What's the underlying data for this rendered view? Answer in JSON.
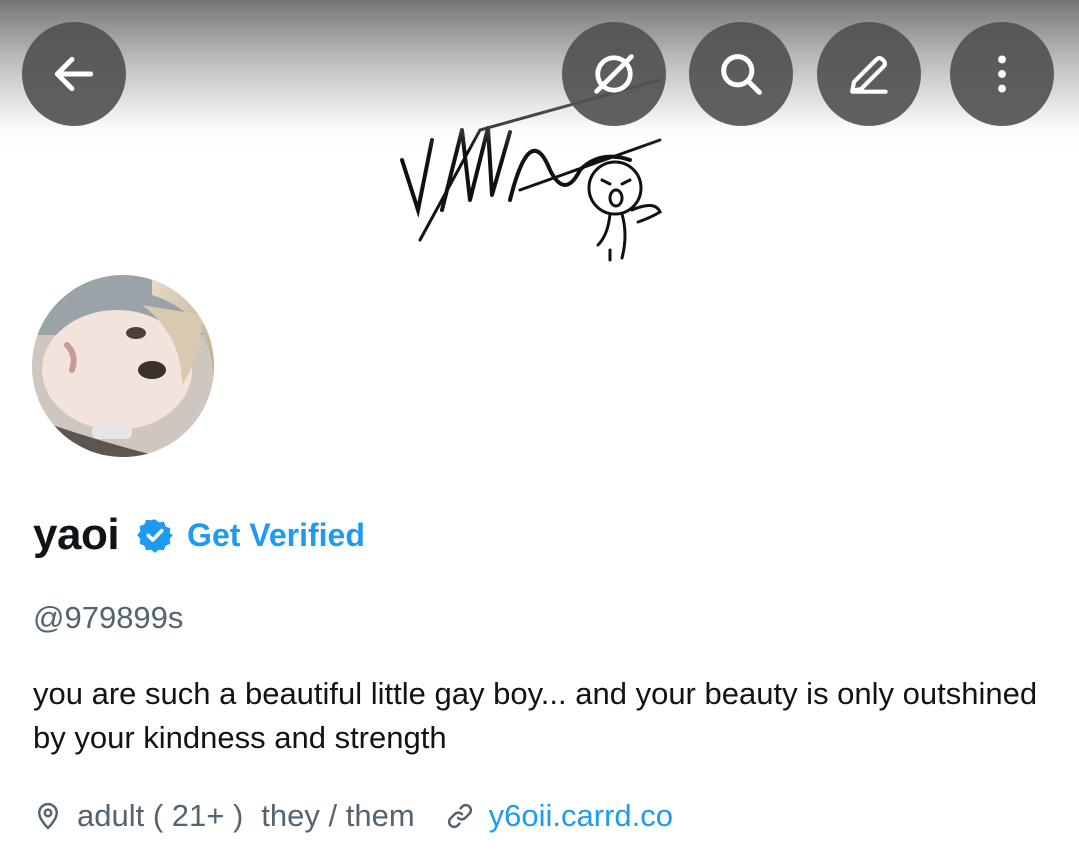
{
  "header": {
    "buttons": [
      {
        "name": "back",
        "icon": "arrow-left-icon"
      },
      {
        "name": "data-saver",
        "icon": "slash-circle-icon"
      },
      {
        "name": "search",
        "icon": "search-icon"
      },
      {
        "name": "edit",
        "icon": "pencil-icon"
      },
      {
        "name": "more",
        "icon": "more-vertical-icon"
      }
    ]
  },
  "banner": {
    "image": "signature-doodle"
  },
  "profile": {
    "display_name": "yaoi",
    "verified_icon": "verified-badge-icon",
    "get_verified_label": "Get Verified",
    "handle": "@979899s",
    "bio": "you are such a beautiful little gay boy...  and your beauty is only outshined by your kindness and strength",
    "location": "adult ( 21+ )",
    "pronouns": "they / them",
    "website": "y6oii.carrd.co"
  },
  "colors": {
    "accent": "#1d9bf0",
    "text_primary": "#0f1419",
    "text_secondary": "#536471",
    "button_bg": "#505050"
  }
}
